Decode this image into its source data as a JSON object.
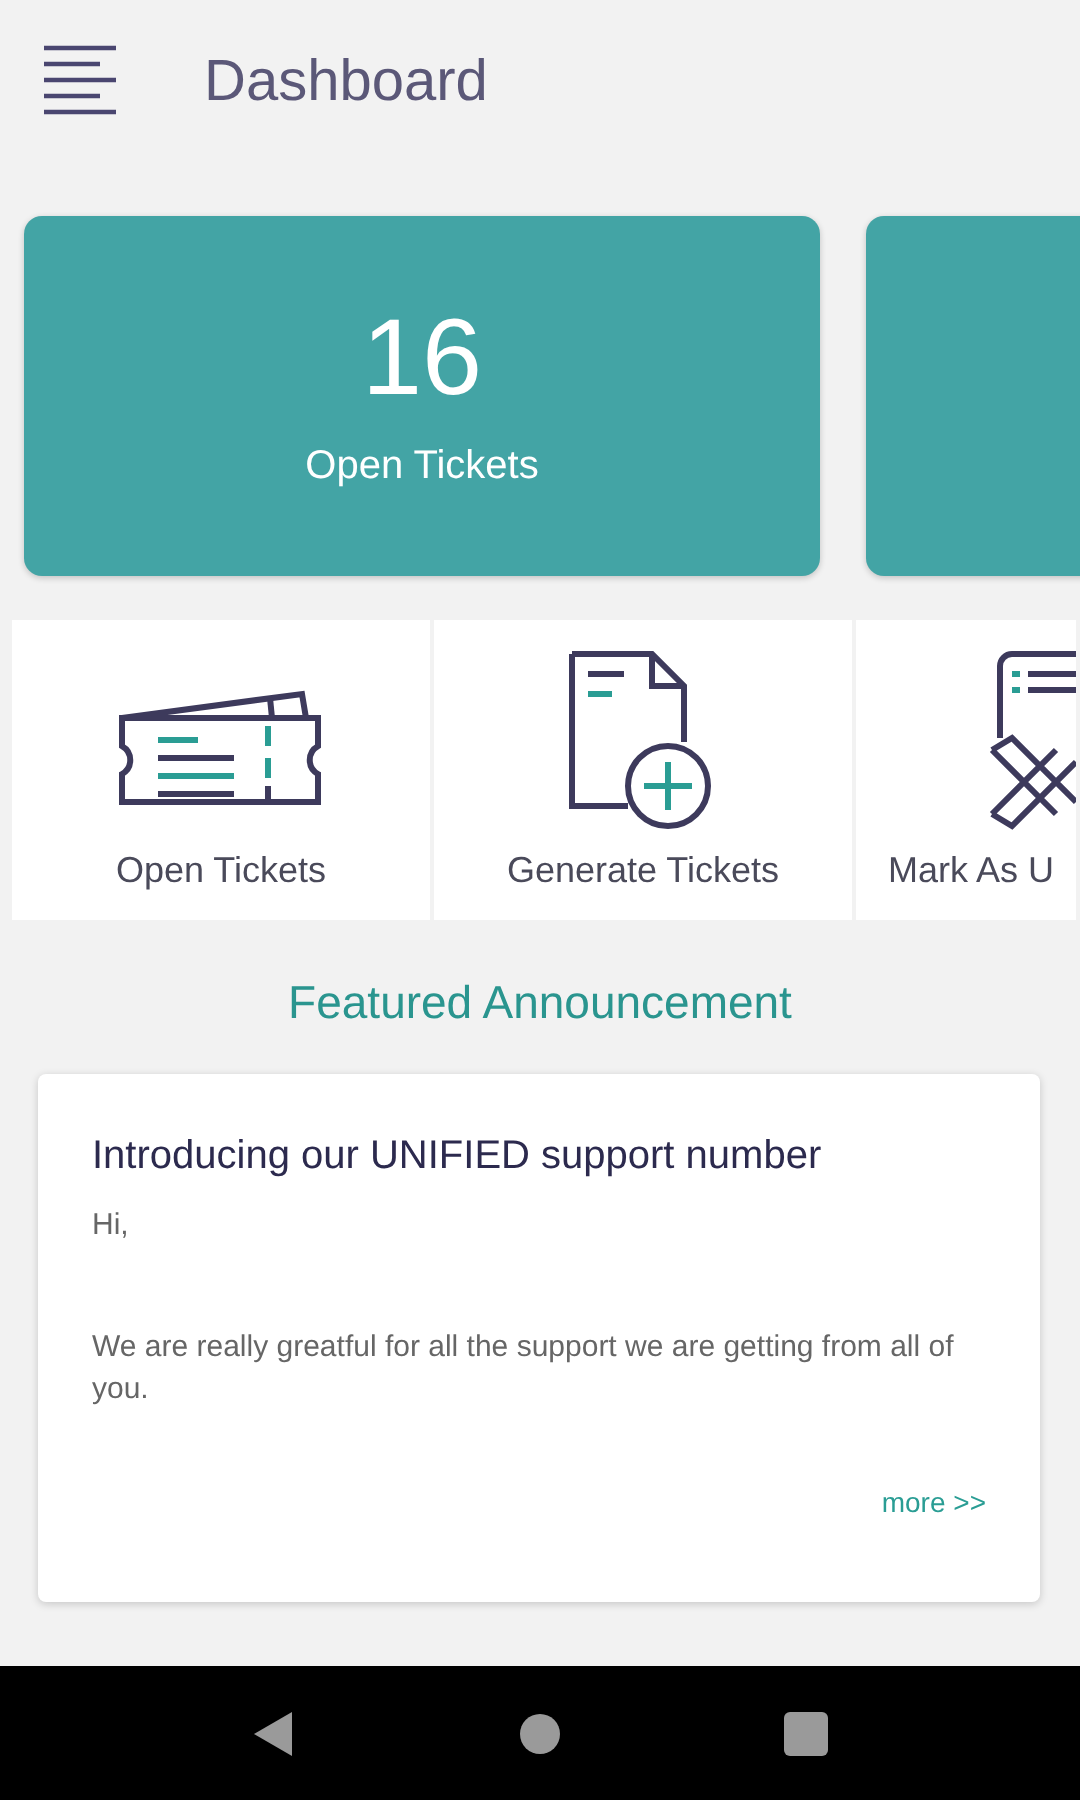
{
  "header": {
    "title": "Dashboard"
  },
  "stat_cards": [
    {
      "kind": "full",
      "count": "16",
      "label": "Open Tickets"
    },
    {
      "kind": "cut"
    }
  ],
  "actions": [
    {
      "label": "Open Tickets"
    },
    {
      "label": "Generate Tickets"
    },
    {
      "label": "Mark As U"
    }
  ],
  "featured": {
    "heading": "Featured Announcement",
    "title": "Introducing our UNIFIED support number",
    "greeting": "Hi,",
    "body": "We are really greatful for all the support we are getting from all of you.",
    "link": "more >>"
  }
}
